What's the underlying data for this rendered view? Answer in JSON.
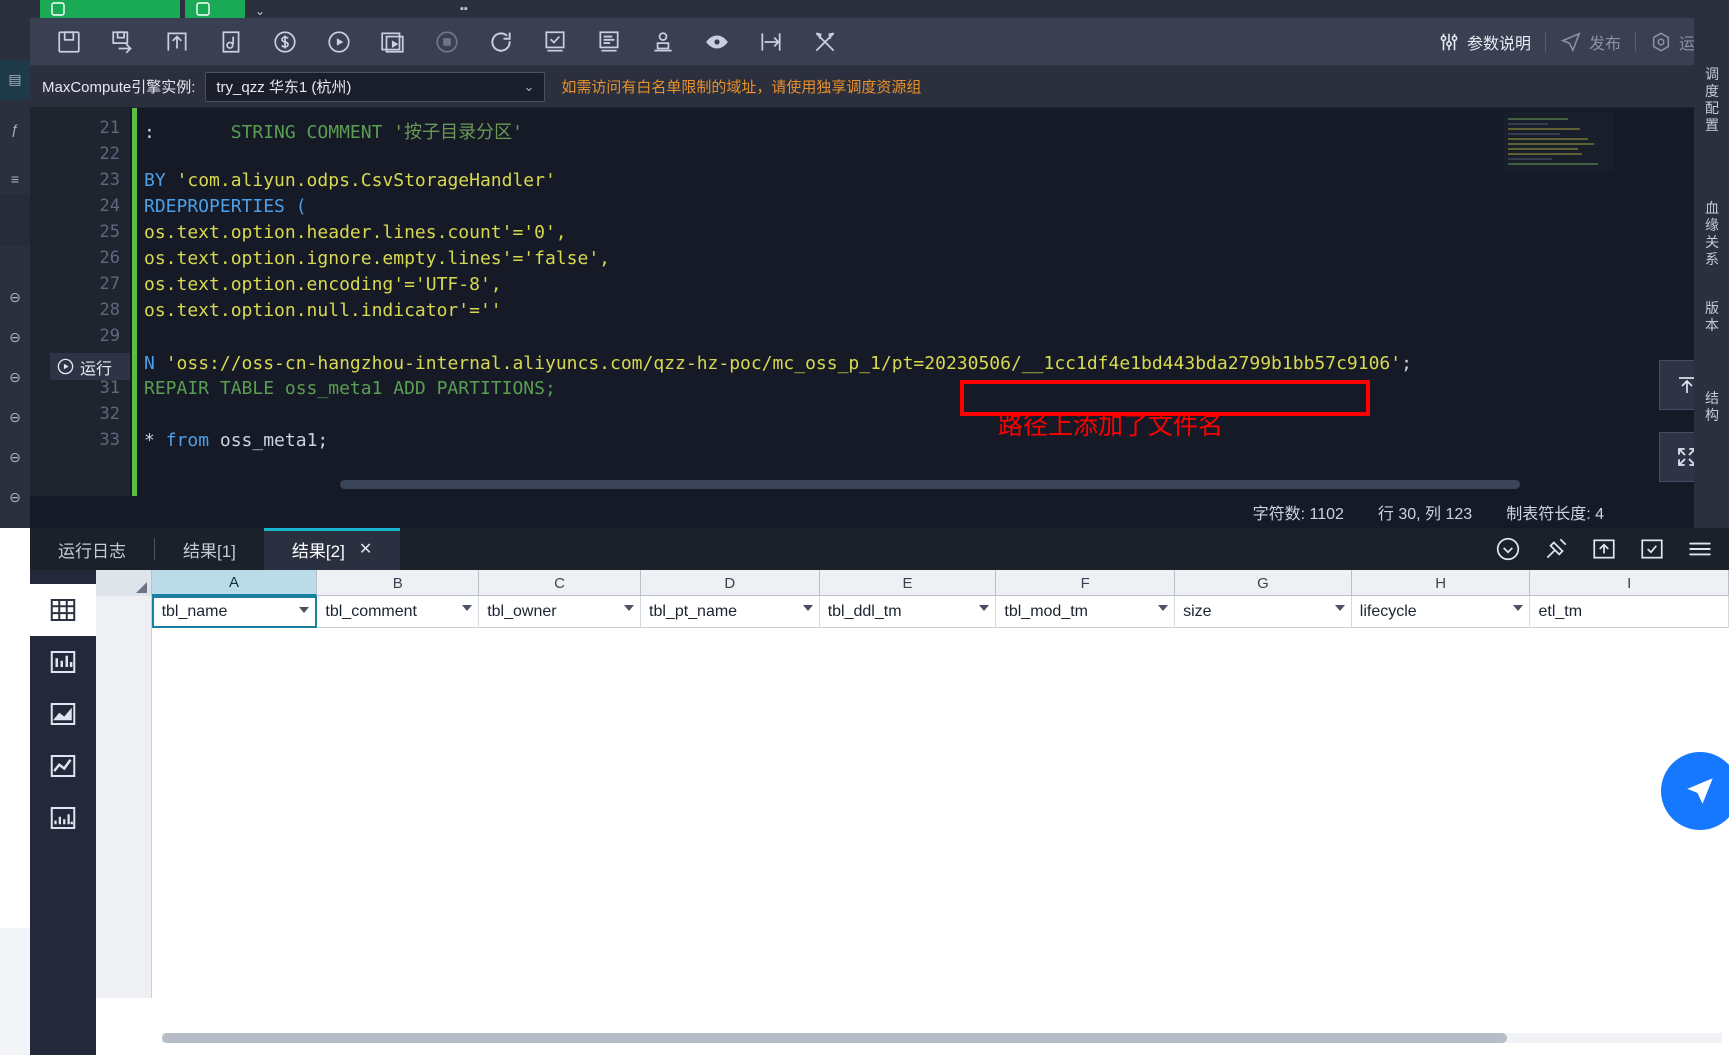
{
  "toolbar": {
    "icons": [
      {
        "name": "save-icon",
        "title": "保存"
      },
      {
        "name": "save-as-icon",
        "title": "另存为"
      },
      {
        "name": "upload-icon",
        "title": "提交"
      },
      {
        "name": "format-icon",
        "title": "格式化"
      },
      {
        "name": "cost-estimate-icon",
        "title": "费用估算"
      },
      {
        "name": "run-icon",
        "title": "运行"
      },
      {
        "name": "run-smoke-icon",
        "title": "冒烟测试"
      },
      {
        "name": "stop-icon",
        "title": "停止"
      },
      {
        "name": "refresh-icon",
        "title": "刷新"
      },
      {
        "name": "check-icon",
        "title": "校验"
      },
      {
        "name": "log-icon",
        "title": "日志"
      },
      {
        "name": "owner-icon",
        "title": "责任人"
      },
      {
        "name": "preview-icon",
        "title": "预览"
      },
      {
        "name": "goto-icon",
        "title": "跳转"
      },
      {
        "name": "tools-icon",
        "title": "工具"
      }
    ],
    "right_items": [
      {
        "name": "params-desc",
        "label": "参数说明",
        "icon": "sliders-icon",
        "dim": false
      },
      {
        "name": "publish",
        "label": "发布",
        "icon": "send-icon",
        "dim": true
      },
      {
        "name": "ops",
        "label": "运维",
        "icon": "hexagon-icon",
        "dim": true
      }
    ]
  },
  "engine_bar": {
    "label": "MaxCompute引擎实例:",
    "selected": "try_qzz 华东1 (杭州)",
    "note": "如需访问有白名单限制的域址，请使用独享调度资源组"
  },
  "editor": {
    "run_marker_label": "运行",
    "lines": [
      {
        "num": "21",
        "segments": [
          {
            "t": ":",
            "c": "k-plain"
          },
          {
            "t": "        STRING COMMENT ",
            "c": "k-sqlg"
          },
          {
            "t": "'按子目录分区'",
            "c": "k-green"
          }
        ]
      },
      {
        "num": "22",
        "segments": []
      },
      {
        "num": "23",
        "segments": [
          {
            "t": "BY ",
            "c": "k-blue"
          },
          {
            "t": "'com.aliyun.odps.CsvStorageHandler'",
            "c": "k-str"
          }
        ]
      },
      {
        "num": "24",
        "segments": [
          {
            "t": "RDEPROPERTIES ",
            "c": "k-blue"
          },
          {
            "t": "(",
            "c": "k-blue"
          }
        ]
      },
      {
        "num": "25",
        "segments": [
          {
            "t": "os.text.option.header.lines.count'='0',",
            "c": "k-str"
          }
        ]
      },
      {
        "num": "26",
        "segments": [
          {
            "t": "os.text.option.ignore.empty.lines'='false',",
            "c": "k-str"
          }
        ]
      },
      {
        "num": "27",
        "segments": [
          {
            "t": "os.text.option.encoding'='UTF-8',",
            "c": "k-str"
          }
        ]
      },
      {
        "num": "28",
        "segments": [
          {
            "t": "os.text.option.null.indicator'=''",
            "c": "k-str"
          }
        ]
      },
      {
        "num": "29",
        "segments": []
      },
      {
        "num": "30",
        "segments": [
          {
            "t": "N ",
            "c": "k-blue"
          },
          {
            "t": "'oss://oss-cn-hangzhou-internal.aliyuncs.com/qzz-hz-poc/mc_oss_p_1/pt=20230506/__1cc1df4e1bd443bda2799b1bb57c9106'",
            "c": "k-str"
          },
          {
            "t": ";",
            "c": "k-plain"
          }
        ]
      },
      {
        "num": "31",
        "segments": [
          {
            "t": "REPAIR TABLE ",
            "c": "k-sqlg"
          },
          {
            "t": "oss_meta1",
            "c": "k-sqlg"
          },
          {
            "t": " ADD PARTITIONS;",
            "c": "k-sqlg"
          }
        ]
      },
      {
        "num": "32",
        "segments": []
      },
      {
        "num": "33",
        "segments": [
          {
            "t": "* ",
            "c": "k-plain"
          },
          {
            "t": "from ",
            "c": "k-blue"
          },
          {
            "t": "oss_meta1;",
            "c": "k-plain"
          }
        ]
      }
    ],
    "annotation": {
      "text": "路径上添加了文件名",
      "color": "#ff0000"
    }
  },
  "status_bar": {
    "char_count": "字符数: 1102",
    "cursor": "行 30, 列 123",
    "tab_len": "制表符长度: 4"
  },
  "results": {
    "tabs": [
      {
        "name": "tab-run-log",
        "label": "运行日志",
        "active": false,
        "closable": false
      },
      {
        "name": "tab-result-1",
        "label": "结果[1]",
        "active": false,
        "closable": false
      },
      {
        "name": "tab-result-2",
        "label": "结果[2]",
        "active": true,
        "closable": true,
        "close_label": "✕"
      }
    ],
    "tools": [
      {
        "name": "download-icon"
      },
      {
        "name": "pin-icon"
      },
      {
        "name": "upload-result-icon"
      },
      {
        "name": "check-box-icon"
      },
      {
        "name": "menu-icon"
      }
    ],
    "side_views": [
      {
        "name": "view-table",
        "icon": "table-icon",
        "active": true
      },
      {
        "name": "view-bar-chart",
        "icon": "bar-chart-icon",
        "active": false
      },
      {
        "name": "view-area-chart",
        "icon": "area-chart-icon",
        "active": false
      },
      {
        "name": "view-line-chart",
        "icon": "line-chart-icon",
        "active": false
      },
      {
        "name": "view-scatter-chart",
        "icon": "scatter-chart-icon",
        "active": false
      }
    ],
    "column_letters": [
      "A",
      "B",
      "C",
      "D",
      "E",
      "F",
      "G",
      "H",
      "I"
    ],
    "selected_column": "A",
    "field_names": [
      "tbl_name",
      "tbl_comment",
      "tbl_owner",
      "tbl_pt_name",
      "tbl_ddl_tm",
      "tbl_mod_tm",
      "size",
      "lifecycle",
      "etl_tm"
    ],
    "selected_field": "tbl_name",
    "rows": []
  },
  "right_rail": {
    "items": [
      "调度配置",
      "血缘关系",
      "版本",
      "结构"
    ]
  },
  "colors": {
    "accent": "#18b7d0",
    "annotation": "#ff0000",
    "warning": "#e8912a",
    "toolbar_bg": "#3a3f52",
    "editor_bg": "#151a26",
    "fab": "#1677ff"
  }
}
